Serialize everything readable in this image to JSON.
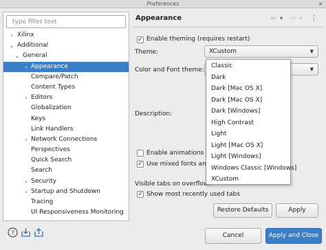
{
  "window": {
    "title": "Preferences",
    "close_glyph": "×"
  },
  "filter": {
    "placeholder": "type filter text"
  },
  "tree": [
    {
      "label": "Xilinx",
      "level": 0,
      "expander": "›"
    },
    {
      "label": "Additional",
      "level": 0,
      "expander": "⌄"
    },
    {
      "label": "General",
      "level": 1,
      "expander": "⌄"
    },
    {
      "label": "Appearance",
      "level": 2,
      "expander": "›",
      "selected": true
    },
    {
      "label": "Compare/Patch",
      "level": 2,
      "expander": ""
    },
    {
      "label": "Content Types",
      "level": 2,
      "expander": ""
    },
    {
      "label": "Editors",
      "level": 2,
      "expander": "›"
    },
    {
      "label": "Globalization",
      "level": 2,
      "expander": ""
    },
    {
      "label": "Keys",
      "level": 2,
      "expander": ""
    },
    {
      "label": "Link Handlers",
      "level": 2,
      "expander": ""
    },
    {
      "label": "Network Connections",
      "level": 2,
      "expander": "›"
    },
    {
      "label": "Perspectives",
      "level": 2,
      "expander": ""
    },
    {
      "label": "Quick Search",
      "level": 2,
      "expander": ""
    },
    {
      "label": "Search",
      "level": 2,
      "expander": ""
    },
    {
      "label": "Security",
      "level": 2,
      "expander": "›"
    },
    {
      "label": "Startup and Shutdown",
      "level": 2,
      "expander": "›"
    },
    {
      "label": "Tracing",
      "level": 2,
      "expander": ""
    },
    {
      "label": "UI Responsiveness Monitoring",
      "level": 2,
      "expander": ""
    }
  ],
  "page": {
    "title": "Appearance",
    "nav": {
      "back": "⇦",
      "back_menu": "▾",
      "forward": "⇨",
      "forward_menu": "▾",
      "menu": "⋮"
    },
    "enable_theming": {
      "label": "Enable theming (requires restart)",
      "checked": true,
      "mark": "✓"
    },
    "theme": {
      "label": "Theme:",
      "value": "XCustom",
      "arrow": "▼"
    },
    "color_font_theme": {
      "label": "Color and Font theme:",
      "arrow": "▼"
    },
    "description": {
      "label": "Description:"
    },
    "enable_animations": {
      "label": "Enable animations",
      "checked": false
    },
    "mixed_fonts": {
      "label": "Use mixed fonts and c",
      "checked": true,
      "mark": "✓"
    },
    "visible_tabs": {
      "label": "Visible tabs on overflow:"
    },
    "show_mru": {
      "label": "Show most recently used tabs",
      "checked": true,
      "mark": "✓"
    },
    "restore_defaults": "Restore Defaults",
    "apply": "Apply"
  },
  "theme_options": [
    "Classic",
    "Dark",
    "Dark [Mac OS X]",
    "Dark [Mac OS X]",
    "Dark [Windows]",
    "High Contrast",
    "Light",
    "Light [Mac OS X]",
    "Light [Windows]",
    "Windows Classic [Windows]",
    "XCustom"
  ],
  "footer": {
    "help_icon": "help-icon",
    "import_icon": "import-icon",
    "export_icon": "export-icon",
    "cancel": "Cancel",
    "apply_and_close": "Apply and Close"
  },
  "colors": {
    "selection": "#3c7fc9",
    "primary_button": "#3c7fc9",
    "nav_back": "#e8a23a"
  }
}
